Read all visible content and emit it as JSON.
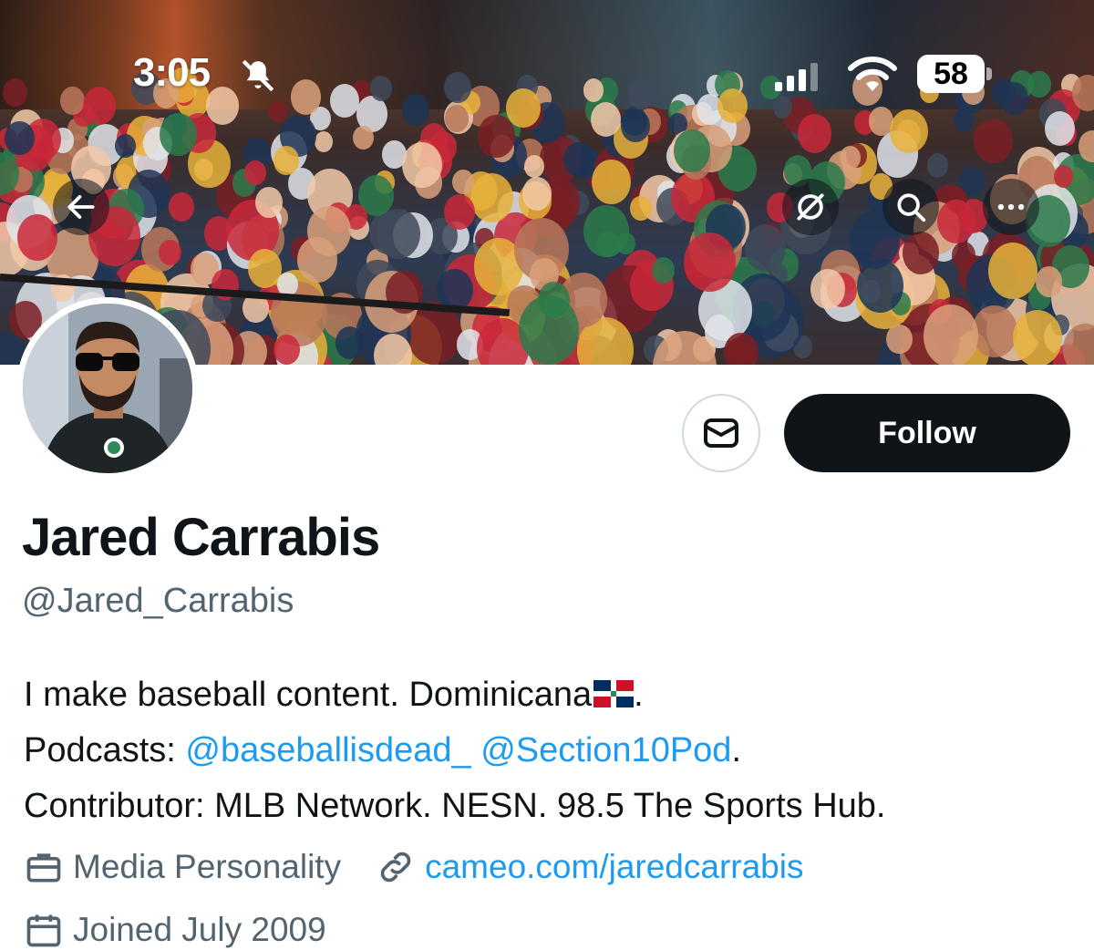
{
  "status_bar": {
    "time": "3:05",
    "battery": "58",
    "icons": [
      "bell-slash-icon",
      "cellular-signal-icon",
      "wifi-icon",
      "battery-icon"
    ]
  },
  "header": {
    "back_icon": "arrow-left-icon",
    "grok_icon": "slashed-circle-icon",
    "search_icon": "search-icon",
    "more_icon": "more-horizontal-icon"
  },
  "profile": {
    "display_name": "Jared Carrabis",
    "handle": "@Jared_Carrabis",
    "follow_label": "Follow",
    "message_icon": "envelope-icon",
    "bio": {
      "line1_text": "I make baseball content. Dominicana",
      "line1_suffix": ".",
      "line2_prefix": "Podcasts: ",
      "mention1": "@baseballisdead_",
      "mention2": "@Section10Pod",
      "line2_suffix": ".",
      "line3": "Contributor: MLB Network. NESN. 98.5 The Sports Hub."
    },
    "category": "Media Personality",
    "website": "cameo.com/jaredcarrabis",
    "joined": "Joined July 2009"
  },
  "colors": {
    "text_primary": "#0f1419",
    "text_secondary": "#536471",
    "link": "#1d9bf0",
    "follow_bg": "#0f1419"
  }
}
